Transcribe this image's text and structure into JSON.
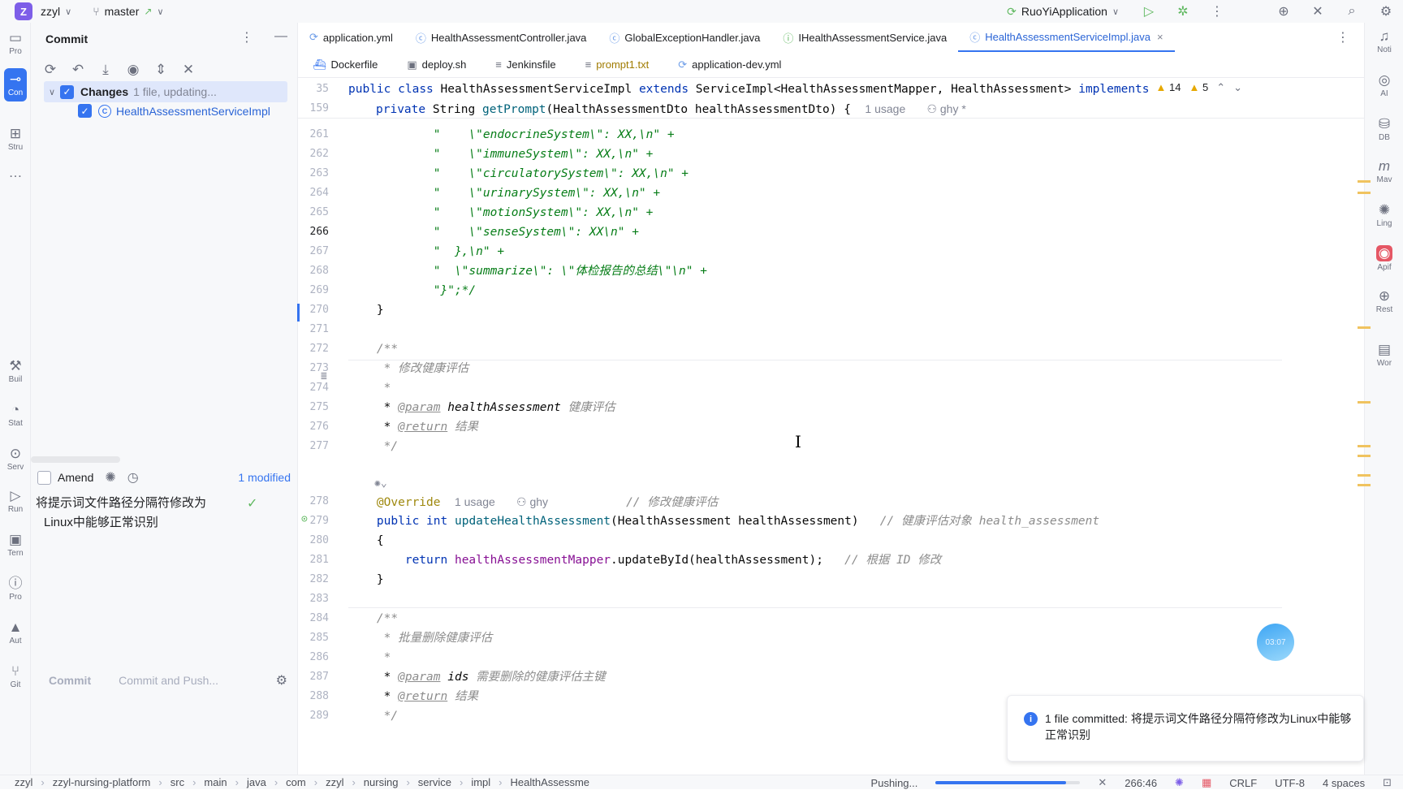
{
  "titlebar": {
    "project_badge": "Z",
    "project_name": "zzyl",
    "branch": "master",
    "run_config": "RuoYiApplication"
  },
  "left_strip": [
    {
      "label": "Pro",
      "icon": "folder-icon"
    },
    {
      "label": "Con",
      "icon": "commit-icon",
      "active": true
    },
    {
      "label": "Stru",
      "icon": "structure-icon"
    },
    {
      "label": "…",
      "icon": "more-icon"
    },
    {
      "label": "Buil",
      "icon": "build-icon"
    },
    {
      "label": "Stat",
      "icon": "statistics-icon"
    },
    {
      "label": "Serv",
      "icon": "services-icon"
    },
    {
      "label": "Run",
      "icon": "run-icon"
    },
    {
      "label": "Tern",
      "icon": "terminal-icon"
    },
    {
      "label": "Pro",
      "icon": "problems-icon"
    },
    {
      "label": "Aut",
      "icon": "warning-icon"
    },
    {
      "label": "Git",
      "icon": "git-icon"
    }
  ],
  "commit_panel": {
    "title": "Commit",
    "changes_label": "Changes",
    "changes_status": "1 file, updating...",
    "file_name": "HealthAssessmentServiceImpl",
    "amend_label": "Amend",
    "modified_count": "1 modified",
    "message_line1": "将提示词文件路径分隔符修改为",
    "message_line2": "Linux中能够正常识别",
    "commit_button": "Commit",
    "commit_push_button": "Commit and Push..."
  },
  "tabs_row1": [
    {
      "label": "application.yml",
      "icon": "yaml-icon",
      "active": false
    },
    {
      "label": "HealthAssessmentController.java",
      "icon": "class-icon",
      "active": false
    },
    {
      "label": "GlobalExceptionHandler.java",
      "icon": "class-icon",
      "active": false
    },
    {
      "label": "IHealthAssessmentService.java",
      "icon": "interface-icon",
      "active": false
    },
    {
      "label": "HealthAssessmentServiceImpl.java",
      "icon": "class-icon",
      "active": true
    }
  ],
  "tabs_row2": [
    {
      "label": "Dockerfile",
      "icon": "docker-icon"
    },
    {
      "label": "deploy.sh",
      "icon": "shell-icon"
    },
    {
      "label": "Jenkinsfile",
      "icon": "text-icon"
    },
    {
      "label": "prompt1.txt",
      "icon": "text-icon"
    },
    {
      "label": "application-dev.yml",
      "icon": "yaml-icon"
    }
  ],
  "inspections": {
    "warnings": "14",
    "weak_warnings": "5"
  },
  "sticky_lines": [
    {
      "num": "35",
      "html_key": "s35"
    },
    {
      "num": "159",
      "html_key": "s159"
    }
  ],
  "code_lines": [
    {
      "num": "261",
      "text": "            \"    \\\"endocrineSystem\\\": XX,\\n\" +",
      "cls": "str"
    },
    {
      "num": "262",
      "text": "            \"    \\\"immuneSystem\\\": XX,\\n\" +",
      "cls": "str"
    },
    {
      "num": "263",
      "text": "            \"    \\\"circulatorySystem\\\": XX,\\n\" +",
      "cls": "str"
    },
    {
      "num": "264",
      "text": "            \"    \\\"urinarySystem\\\": XX,\\n\" +",
      "cls": "str"
    },
    {
      "num": "265",
      "text": "            \"    \\\"motionSystem\\\": XX,\\n\" +",
      "cls": "str"
    },
    {
      "num": "266",
      "text": "            \"    \\\"senseSystem\\\": XX\\n\" +",
      "cls": "str",
      "current": true
    },
    {
      "num": "267",
      "text": "            \"  },\\n\" +",
      "cls": "str"
    },
    {
      "num": "268",
      "text": "            \"  \\\"summarize\\\": \\\"体检报告的总结\\\"\\n\" +",
      "cls": "str"
    },
    {
      "num": "269",
      "text": "            \"}\";*/",
      "cls": "str"
    },
    {
      "num": "270",
      "text": "    }",
      "cls": "plain"
    },
    {
      "num": "271",
      "text": "",
      "cls": "plain"
    },
    {
      "num": "272",
      "text": "    /**",
      "cls": "cmt"
    },
    {
      "num": "273",
      "text": "     * 修改健康评估",
      "cls": "cmt"
    },
    {
      "num": "274",
      "text": "     *",
      "cls": "cmt"
    },
    {
      "num": "275",
      "text": "PARAM1",
      "cls": "special"
    },
    {
      "num": "276",
      "text": "RETURN1",
      "cls": "special"
    },
    {
      "num": "277",
      "text": "     */",
      "cls": "cmt"
    }
  ],
  "code_lines_b": [
    {
      "num": "278",
      "text": "OVERRIDE",
      "cls": "special"
    },
    {
      "num": "279",
      "text": "SIG",
      "cls": "special"
    },
    {
      "num": "280",
      "text": "    {",
      "cls": "plain"
    },
    {
      "num": "281",
      "text": "RET",
      "cls": "special"
    },
    {
      "num": "282",
      "text": "    }",
      "cls": "plain"
    },
    {
      "num": "283",
      "text": "",
      "cls": "plain"
    },
    {
      "num": "284",
      "text": "    /**",
      "cls": "cmt"
    },
    {
      "num": "285",
      "text": "     * 批量删除健康评估",
      "cls": "cmt"
    },
    {
      "num": "286",
      "text": "     *",
      "cls": "cmt"
    },
    {
      "num": "287",
      "text": "PARAM2",
      "cls": "special"
    },
    {
      "num": "288",
      "text": "RETURN2",
      "cls": "special"
    },
    {
      "num": "289",
      "text": "     */",
      "cls": "cmt"
    }
  ],
  "code_tokens": {
    "s35_public": "public",
    "s35_class": "class",
    "s35_name": "HealthAssessmentServiceImpl",
    "s35_extends": "extends",
    "s35_super": "ServiceImpl<HealthAssessmentMapper, HealthAssessment>",
    "s35_implements": "implements",
    "s159_private": "private",
    "s159_type": "String",
    "s159_method": "getPrompt",
    "s159_params": "(HealthAssessmentDto healthAssessmentDto) {",
    "s159_usage": "1 usage",
    "s159_author": "ghy *",
    "param_tag": "@param",
    "param1_name": "healthAssessment",
    "param1_desc": "健康评估",
    "return_tag": "@return",
    "return1_desc": "结果",
    "override": "@Override",
    "override_usage": "1 usage",
    "override_author": "ghy",
    "override_comment": "// 修改健康评估",
    "sig_public": "public",
    "sig_int": "int",
    "sig_method": "updateHealthAssessment",
    "sig_params": "(HealthAssessment healthAssessment)",
    "sig_comment": "// 健康评估对象 health_assessment",
    "ret_kw": "return",
    "ret_field": "healthAssessmentMapper",
    "ret_call": ".updateById(healthAssessment);",
    "ret_comment": "// 根据 ID 修改",
    "param2_name": "ids",
    "param2_desc": "需要删除的健康评估主键",
    "return2_desc": "结果"
  },
  "right_strip": [
    {
      "label": "Noti",
      "icon": "bell-icon"
    },
    {
      "label": "AI",
      "icon": "ai-icon"
    },
    {
      "label": "DB",
      "icon": "database-icon"
    },
    {
      "label": "Mav",
      "icon": "maven-icon"
    },
    {
      "label": "Ling",
      "icon": "lingma-icon"
    },
    {
      "label": "Apif",
      "icon": "apifox-icon"
    },
    {
      "label": "Rest",
      "icon": "globe-icon"
    },
    {
      "label": "Wor",
      "icon": "translate-icon"
    }
  ],
  "notification": {
    "text": "1 file committed: 将提示词文件路径分隔符修改为Linux中能够正常识别"
  },
  "timer": "03:07",
  "statusbar": {
    "breadcrumbs": [
      "zzyl",
      "zzyl-nursing-platform",
      "src",
      "main",
      "java",
      "com",
      "zzyl",
      "nursing",
      "service",
      "impl",
      "HealthAssessme"
    ],
    "pushing": "Pushing...",
    "progress": 0.9,
    "position": "266:46",
    "line_sep": "CRLF",
    "encoding": "UTF-8",
    "indent": "4 spaces"
  }
}
